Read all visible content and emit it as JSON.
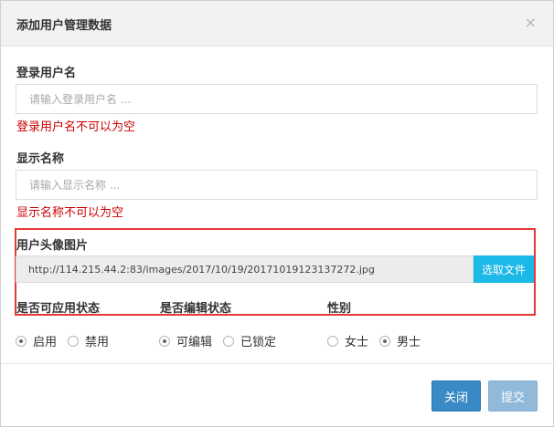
{
  "modal": {
    "title": "添加用户管理数据",
    "close_symbol": "×"
  },
  "login_name": {
    "label": "登录用户名",
    "placeholder": "请输入登录用户名 ...",
    "error": "登录用户名不可以为空"
  },
  "display_name": {
    "label": "显示名称",
    "placeholder": "请输入显示名称 ...",
    "error": "显示名称不可以为空"
  },
  "avatar": {
    "label": "用户头像图片",
    "path": "http://114.215.44.2:83/images/2017/10/19/20171019123137272.jpg",
    "pick_button": "选取文件"
  },
  "status": {
    "label": "是否可应用状态",
    "options": [
      "启用",
      "禁用"
    ],
    "selected": "启用"
  },
  "edit_state": {
    "label": "是否编辑状态",
    "options": [
      "可编辑",
      "已锁定"
    ],
    "selected": "可编辑"
  },
  "gender": {
    "label": "性别",
    "options": [
      "女士",
      "男士"
    ],
    "selected": "男士"
  },
  "footer": {
    "close_label": "关闭",
    "submit_label": "提交"
  },
  "colors": {
    "error": "#cc0000",
    "highlight_border": "#e53935",
    "pick_button": "#1bb8e8",
    "primary_button": "#3a8ac6",
    "disabled_button": "#90b9da"
  }
}
